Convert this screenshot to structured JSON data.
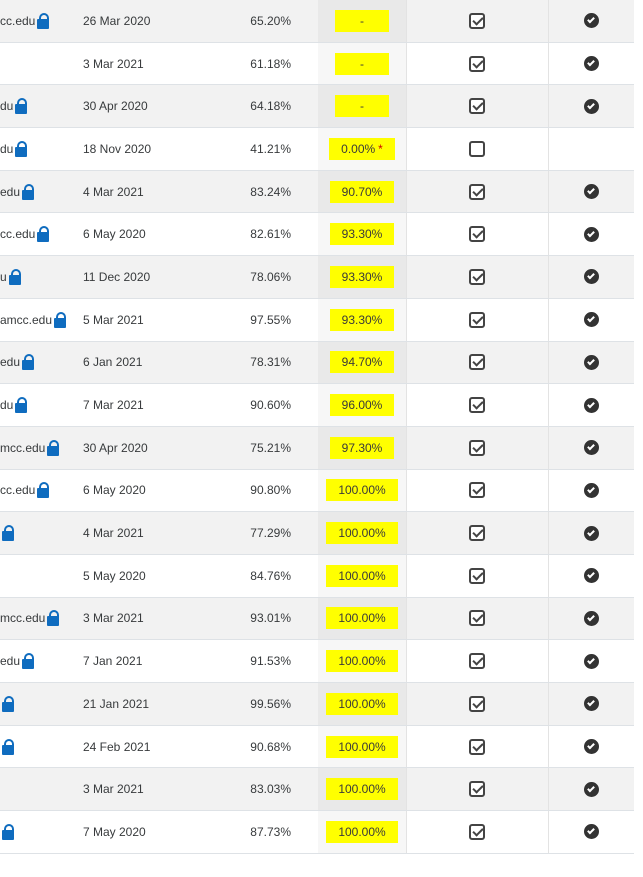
{
  "rows": [
    {
      "email": "cc.edu",
      "lock": true,
      "date": "26 Mar 2020",
      "pct": "65.20%",
      "score": "-",
      "dash": true,
      "checked": true,
      "badge": true
    },
    {
      "email": "",
      "lock": false,
      "date": "3 Mar 2021",
      "pct": "61.18%",
      "score": "-",
      "dash": true,
      "checked": true,
      "badge": true
    },
    {
      "email": "du",
      "lock": true,
      "date": "30 Apr 2020",
      "pct": "64.18%",
      "score": "-",
      "dash": true,
      "checked": true,
      "badge": true
    },
    {
      "email": "du",
      "lock": true,
      "date": "18 Nov 2020",
      "pct": "41.21%",
      "score": "0.00%",
      "star": "*",
      "checked": false,
      "badge": false
    },
    {
      "email": "edu",
      "lock": true,
      "date": "4 Mar 2021",
      "pct": "83.24%",
      "score": "90.70%",
      "checked": true,
      "badge": true
    },
    {
      "email": "cc.edu",
      "lock": true,
      "date": "6 May 2020",
      "pct": "82.61%",
      "score": "93.30%",
      "checked": true,
      "badge": true
    },
    {
      "email": "u",
      "lock": true,
      "date": "11 Dec 2020",
      "pct": "78.06%",
      "score": "93.30%",
      "checked": true,
      "badge": true
    },
    {
      "email": "amcc.edu",
      "lock": true,
      "date": "5 Mar 2021",
      "pct": "97.55%",
      "score": "93.30%",
      "checked": true,
      "badge": true
    },
    {
      "email": "edu",
      "lock": true,
      "date": "6 Jan 2021",
      "pct": "78.31%",
      "score": "94.70%",
      "checked": true,
      "badge": true
    },
    {
      "email": "du",
      "lock": true,
      "date": "7 Mar 2021",
      "pct": "90.60%",
      "score": "96.00%",
      "checked": true,
      "badge": true
    },
    {
      "email": "mcc.edu",
      "lock": true,
      "date": "30 Apr 2020",
      "pct": "75.21%",
      "score": "97.30%",
      "checked": true,
      "badge": true
    },
    {
      "email": "cc.edu",
      "lock": true,
      "date": "6 May 2020",
      "pct": "90.80%",
      "score": "100.00%",
      "checked": true,
      "badge": true
    },
    {
      "email": "",
      "lock": true,
      "date": "4 Mar 2021",
      "pct": "77.29%",
      "score": "100.00%",
      "checked": true,
      "badge": true
    },
    {
      "email": "",
      "lock": false,
      "date": "5 May 2020",
      "pct": "84.76%",
      "score": "100.00%",
      "checked": true,
      "badge": true
    },
    {
      "email": "mcc.edu",
      "lock": true,
      "date": "3 Mar 2021",
      "pct": "93.01%",
      "score": "100.00%",
      "checked": true,
      "badge": true
    },
    {
      "email": "edu",
      "lock": true,
      "date": "7 Jan 2021",
      "pct": "91.53%",
      "score": "100.00%",
      "checked": true,
      "badge": true
    },
    {
      "email": "",
      "lock": true,
      "date": "21 Jan 2021",
      "pct": "99.56%",
      "score": "100.00%",
      "checked": true,
      "badge": true
    },
    {
      "email": "",
      "lock": true,
      "date": "24 Feb 2021",
      "pct": "90.68%",
      "score": "100.00%",
      "checked": true,
      "badge": true
    },
    {
      "email": "",
      "lock": false,
      "date": "3 Mar 2021",
      "pct": "83.03%",
      "score": "100.00%",
      "checked": true,
      "badge": true
    },
    {
      "email": "",
      "lock": true,
      "date": "7 May 2020",
      "pct": "87.73%",
      "score": "100.00%",
      "checked": true,
      "badge": true
    }
  ],
  "colors": {
    "highlight": "#ffff00",
    "lock": "#0f6cbf",
    "check": "#444444"
  }
}
